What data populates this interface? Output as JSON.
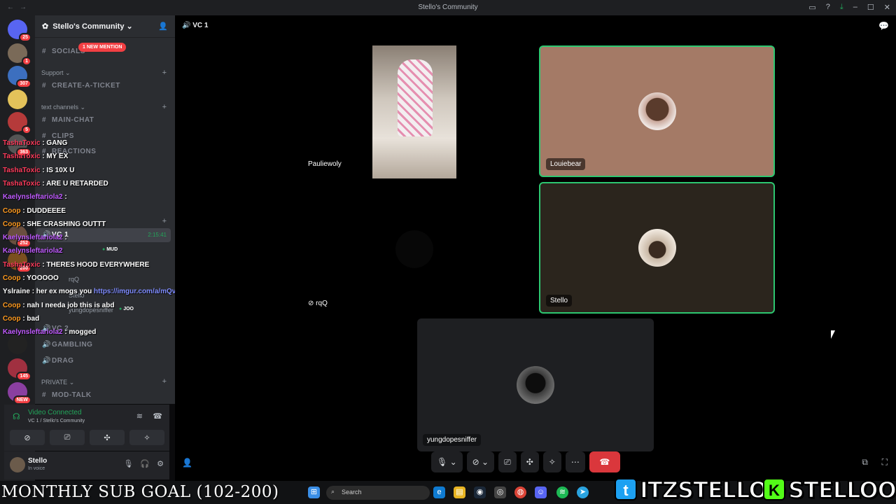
{
  "window": {
    "title": "Stello's Community"
  },
  "servers": [
    {
      "badge": "25",
      "color": "#5865f2"
    },
    {
      "badge": "1",
      "color": "#7a6a58"
    },
    {
      "badge": "307",
      "color": "#3c6fbf"
    },
    {
      "badge": "",
      "color": "#e3c25a"
    },
    {
      "badge": "5",
      "color": "#b53a3a"
    },
    {
      "badge": "363",
      "color": "#555"
    },
    {
      "badge": "252",
      "color": "#6a4f3f"
    },
    {
      "badge": "200",
      "color": "#7a4f1f"
    },
    {
      "badge": "",
      "color": "#222"
    },
    {
      "badge": "145",
      "color": "#a03040"
    },
    {
      "badge": "NEW",
      "color": "#8a3fa0"
    }
  ],
  "sidebar": {
    "guild_name": "Stello's Community",
    "new_mention": "1 NEW MENTION",
    "channels": {
      "socials": "SOCIALS",
      "support_cat": "Support",
      "create_ticket": "CREATE-A-TICKET",
      "text_cat": "text channels",
      "main_chat": "MAIN-CHAT",
      "clips": "CLIPS",
      "reactions": "REACTIONS",
      "vc1": "VC 1",
      "vc1_time": "2:15:41",
      "mud": "MUD",
      "rqq": "rqQ",
      "stello": "Stello",
      "yung": "yungdopesniffer",
      "joo": "JOO",
      "vc2": "VC 2",
      "gambling": "GAMBLING",
      "drag": "DRAG",
      "private_cat": "PRIVATE",
      "mod_talk": "MOD-TALK"
    }
  },
  "chat_overlay": [
    {
      "user": "TashaToxic",
      "cls": "u-red",
      "msg": ": GANG"
    },
    {
      "user": "TashaToxic",
      "cls": "u-red",
      "msg": ": MY EX"
    },
    {
      "user": "TashaToxic",
      "cls": "u-red",
      "msg": ": IS 10X U"
    },
    {
      "user": "TashaToxic",
      "cls": "u-red",
      "msg": ": ARE U RETARDED"
    },
    {
      "user": "Kaelynsleftariola2",
      "cls": "u-pur",
      "msg": ":"
    },
    {
      "user": "Coop",
      "cls": "u-org",
      "msg": ": DUDDEEEE"
    },
    {
      "user": "Coop",
      "cls": "u-org",
      "msg": ": SHE CRASHING OUTTT"
    },
    {
      "user": "Kaelynsleftariola2",
      "cls": "u-pur",
      "msg": ":"
    },
    {
      "user": "Kaelynsleftariola2",
      "cls": "u-pur",
      "msg": ""
    },
    {
      "user": "TashaToxic",
      "cls": "u-red",
      "msg": ": THERES HOOD EVERYWHERE"
    },
    {
      "user": "Coop",
      "cls": "u-org",
      "msg": ": YOOOOO"
    },
    {
      "user": "Yslraine",
      "cls": "u-wht",
      "msg": ": her ex mogs you",
      "link": "https://imgur.com/a/mQvFrIC"
    },
    {
      "user": "Coop",
      "cls": "u-org",
      "msg": ": nah I needa job this is abd"
    },
    {
      "user": "Coop",
      "cls": "u-org",
      "msg": ": bad"
    },
    {
      "user": "Kaelynsleftariola2",
      "cls": "u-pur",
      "msg": ": mogged"
    }
  ],
  "voice_status": {
    "status": "Video Connected",
    "sub": "VC 1 / Stello's Community"
  },
  "user_panel": {
    "name": "Stello",
    "status": "In voice"
  },
  "stage": {
    "channel": "VC 1",
    "tiles": [
      {
        "label": "Pauliewoly"
      },
      {
        "label": "Louiebear"
      },
      {
        "label": "rqQ"
      },
      {
        "label": "Stello"
      },
      {
        "label": "yungdopesniffer"
      }
    ]
  },
  "taskbar": {
    "search": "Search",
    "goal": "MONTHLY SUB GOAL (102-200)"
  },
  "socials": {
    "twitter": "ITZSTELLOO",
    "kick": "STELLOOO"
  }
}
